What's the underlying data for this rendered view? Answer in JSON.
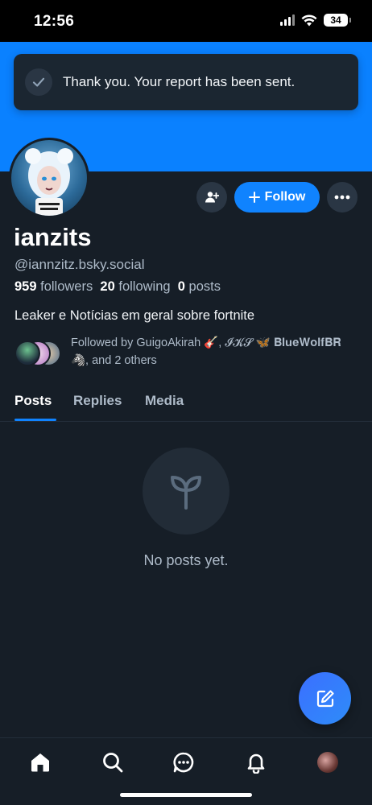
{
  "status_bar": {
    "time": "12:56",
    "battery": "34"
  },
  "toast": {
    "message": "Thank you. Your report has been sent."
  },
  "profile": {
    "display_name": "ianzits",
    "handle": "@iannzitz.bsky.social",
    "followers_count": "959",
    "followers_label": "followers",
    "following_count": "20",
    "following_label": "following",
    "posts_count": "0",
    "posts_label": "posts",
    "bio": "Leaker e Notícias em geral sobre fortnite",
    "followed_by": "Followed by GuigoAkirah 🎸, 𝓘𝓚𝓢 🦋 𝐁𝐥𝐮𝐞𝐖𝐨𝐥𝐟𝐁𝐑 🦓, and 2 others"
  },
  "actions": {
    "follow_label": "Follow"
  },
  "tabs": [
    {
      "label": "Posts",
      "active": true
    },
    {
      "label": "Replies",
      "active": false
    },
    {
      "label": "Media",
      "active": false
    }
  ],
  "empty_state": {
    "text": "No posts yet."
  },
  "nav": {
    "items": [
      "home-icon",
      "search-icon",
      "chat-icon",
      "bell-icon",
      "profile-avatar"
    ]
  },
  "colors": {
    "accent": "#1083fe",
    "banner": "#0a81ff",
    "background": "#161e27"
  }
}
